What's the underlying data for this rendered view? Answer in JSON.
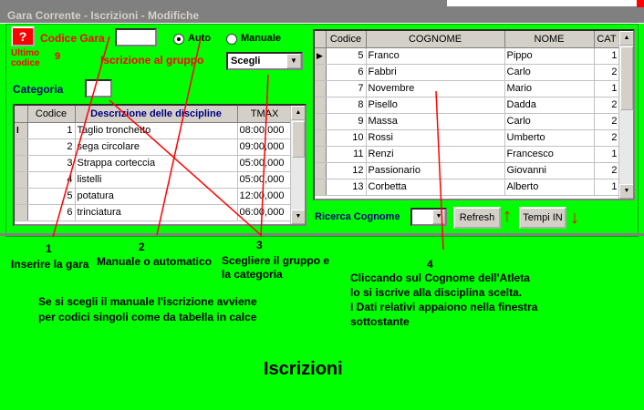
{
  "window": {
    "title": "Gara Corrente  - Iscrizioni - Modifiche"
  },
  "header": {
    "help_label": "?",
    "codice_gara_label": "Codice Gara",
    "codice_gara_value": "",
    "ultimo_codice_label": "Ultimo codice",
    "ultimo_codice_value": "9",
    "radio_auto_label": "Auto",
    "radio_manuale_label": "Manuale",
    "iscrizione_gruppo_label": "Iscrizione al gruppo",
    "gruppo_selected": "Scegli",
    "categoria_label": "Categoria",
    "categoria_value": ""
  },
  "discipline_grid": {
    "columns": [
      "Codice",
      "Descrizione delle discipline",
      "TMAX"
    ],
    "rows": [
      {
        "codice": "1",
        "descrizione": "Taglio tronchetto",
        "tmax": "08:00,000"
      },
      {
        "codice": "2",
        "descrizione": "sega circolare",
        "tmax": "09:00,000"
      },
      {
        "codice": "3",
        "descrizione": "Strappa corteccia",
        "tmax": "05:00,000"
      },
      {
        "codice": "4",
        "descrizione": "listelli",
        "tmax": "05:00,000"
      },
      {
        "codice": "5",
        "descrizione": "potatura",
        "tmax": "12:00,000"
      },
      {
        "codice": "6",
        "descrizione": "trinciatura",
        "tmax": "06:00,000"
      }
    ]
  },
  "atleti_grid": {
    "columns": [
      "Codice",
      "COGNOME",
      "NOME",
      "CAT"
    ],
    "rows": [
      {
        "codice": "5",
        "cognome": "Franco",
        "nome": "Pippo",
        "cat": "1"
      },
      {
        "codice": "6",
        "cognome": "Fabbri",
        "nome": "Carlo",
        "cat": "2"
      },
      {
        "codice": "7",
        "cognome": "Novembre",
        "nome": "Mario",
        "cat": "1"
      },
      {
        "codice": "8",
        "cognome": "Pisello",
        "nome": "Dadda",
        "cat": "2"
      },
      {
        "codice": "9",
        "cognome": "Massa",
        "nome": "Carlo",
        "cat": "2"
      },
      {
        "codice": "10",
        "cognome": "Rossi",
        "nome": "Umberto",
        "cat": "2"
      },
      {
        "codice": "11",
        "cognome": "Renzi",
        "nome": "Francesco",
        "cat": "1"
      },
      {
        "codice": "12",
        "cognome": "Passionario",
        "nome": "Giovanni",
        "cat": "2"
      },
      {
        "codice": "13",
        "cognome": "Corbetta",
        "nome": "Alberto",
        "cat": "1"
      }
    ]
  },
  "search": {
    "label": "Ricerca Cognome",
    "refresh_label": "Refresh",
    "tempi_label": "Tempi IN"
  },
  "annotations": {
    "n1": "1",
    "n1_text": "Inserire la gara",
    "n2": "2",
    "n2_text": "Manuale o automatico",
    "n3": "3",
    "n3_text_1": "Scegliere il gruppo e",
    "n3_text_2": "la categoria",
    "n4": "4",
    "n4_text_1": "Cliccando sul Cognome dell'Atleta",
    "n4_text_2": "lo si iscrive alla disciplina scelta.",
    "n4_text_3": "I Dati relativi appaiono nella finestra",
    "n4_text_4": "sottostante",
    "manual_note_1": "Se si scegli il manuale l'iscrizione avviene",
    "manual_note_2": "per codici singoli come da tabella in calce",
    "footer_title": "Iscrizioni"
  },
  "colors": {
    "background": "#00ff00",
    "accent_red": "#ff0000",
    "header_blue": "#000080"
  },
  "icons": {
    "up": "arrow-up-icon",
    "down": "arrow-down-icon",
    "record": "record-pointer-icon"
  }
}
